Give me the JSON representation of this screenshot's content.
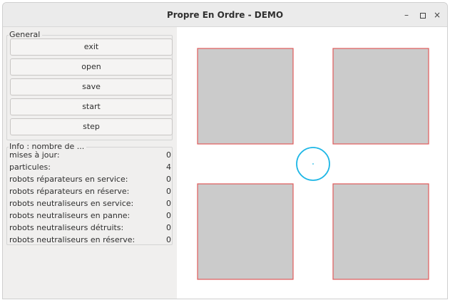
{
  "window": {
    "title": "Propre En Ordre - DEMO",
    "controls": {
      "minimize": "–",
      "maximize": "□",
      "close": "×"
    }
  },
  "general": {
    "title": "General",
    "buttons": [
      "exit",
      "open",
      "save",
      "start",
      "step"
    ]
  },
  "info": {
    "title": "Info : nombre de ...",
    "rows": [
      {
        "label": "mises à jour:",
        "value": "0"
      },
      {
        "label": "particules:",
        "value": "4"
      },
      {
        "label": "robots réparateurs en service:",
        "value": "0"
      },
      {
        "label": "robots réparateurs en réserve:",
        "value": "0"
      },
      {
        "label": "robots neutraliseurs en service:",
        "value": "0"
      },
      {
        "label": "robots neutraliseurs en panne:",
        "value": "0"
      },
      {
        "label": "robots neutraliseurs détruits:",
        "value": "0"
      },
      {
        "label": "robots neutraliseurs en réserve:",
        "value": "0"
      }
    ]
  },
  "colors": {
    "particle_fill": "#cbcbcb",
    "particle_border": "#e05a5a",
    "robot_circle": "#1fb7e6"
  }
}
